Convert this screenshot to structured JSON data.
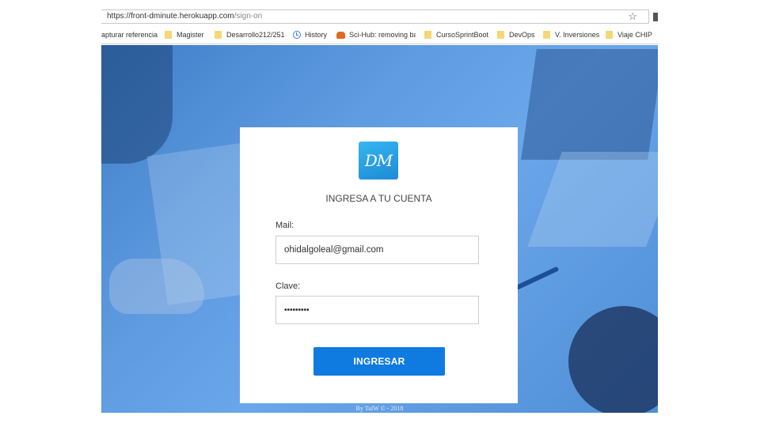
{
  "browser": {
    "url_host": "https://front-dminute.herokuapp.com",
    "url_path": "/sign-on",
    "bookmarks": [
      {
        "label": "apturar referencia",
        "icon": "none"
      },
      {
        "label": "Magister",
        "icon": "folder-icon"
      },
      {
        "label": "Desarrollo212/251",
        "icon": "folder-icon"
      },
      {
        "label": "History",
        "icon": "history-icon"
      },
      {
        "label": "Sci-Hub: removing ba",
        "icon": "scihub-icon"
      },
      {
        "label": "CursoSprintBoot",
        "icon": "folder-icon"
      },
      {
        "label": "DevOps",
        "icon": "folder-icon"
      },
      {
        "label": "V. Inversiones",
        "icon": "folder-icon"
      },
      {
        "label": "Viaje CHIP",
        "icon": "folder-icon"
      }
    ]
  },
  "login": {
    "logo_text": "DM",
    "title": "INGRESA A TU CUENTA",
    "mail_label": "Mail:",
    "mail_value": "ohidalgoleal@gmail.com",
    "password_label": "Clave:",
    "password_value": "•••••••••",
    "submit_label": "INGRESAR"
  },
  "footer": {
    "text": "By TaIW © - 2018"
  },
  "colors": {
    "button": "#0f7be0",
    "logo": "#1e8ad6",
    "background": "#5f9be0"
  }
}
